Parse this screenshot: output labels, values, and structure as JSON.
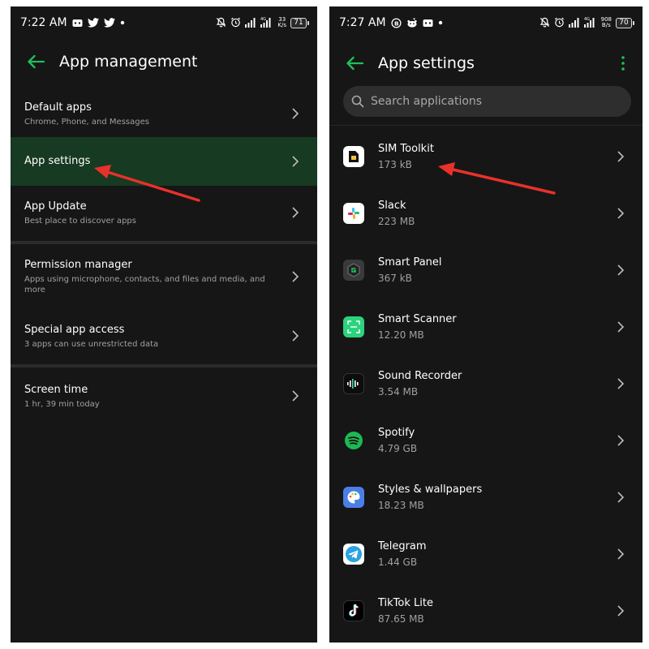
{
  "left": {
    "status": {
      "time": "7:22 AM",
      "net_speed_value": "33",
      "net_speed_unit": "K/s",
      "battery": "71"
    },
    "title": "App management",
    "items": [
      {
        "title": "Default apps",
        "subtitle": "Chrome, Phone, and Messages"
      },
      {
        "title": "App settings",
        "subtitle": ""
      },
      {
        "title": "App Update",
        "subtitle": "Best place to discover apps"
      },
      {
        "title": "Permission manager",
        "subtitle": "Apps using microphone, contacts, and files and media, and more"
      },
      {
        "title": "Special app access",
        "subtitle": "3 apps can use unrestricted data"
      },
      {
        "title": "Screen time",
        "subtitle": "1 hr, 39 min today"
      }
    ]
  },
  "right": {
    "status": {
      "time": "7:27 AM",
      "net_speed_value": "908",
      "net_speed_unit": "B/s",
      "battery": "70"
    },
    "title": "App settings",
    "search": {
      "placeholder": "Search applications"
    },
    "apps": [
      {
        "name": "SIM Toolkit",
        "size": "173 kB",
        "icon": "sim-card-icon"
      },
      {
        "name": "Slack",
        "size": "223 MB",
        "icon": "slack-icon"
      },
      {
        "name": "Smart Panel",
        "size": "367 kB",
        "icon": "smart-panel-icon"
      },
      {
        "name": "Smart Scanner",
        "size": "12.20 MB",
        "icon": "scanner-icon"
      },
      {
        "name": "Sound Recorder",
        "size": "3.54 MB",
        "icon": "sound-wave-icon"
      },
      {
        "name": "Spotify",
        "size": "4.79 GB",
        "icon": "spotify-icon"
      },
      {
        "name": "Styles & wallpapers",
        "size": "18.23 MB",
        "icon": "palette-icon"
      },
      {
        "name": "Telegram",
        "size": "1.44 GB",
        "icon": "telegram-icon"
      },
      {
        "name": "TikTok Lite",
        "size": "87.65 MB",
        "icon": "tiktok-icon"
      }
    ]
  },
  "colors": {
    "accent": "#1fbf5a",
    "selected_row": "#173a22",
    "background": "#161616",
    "annotation_arrow": "#e8312a"
  }
}
